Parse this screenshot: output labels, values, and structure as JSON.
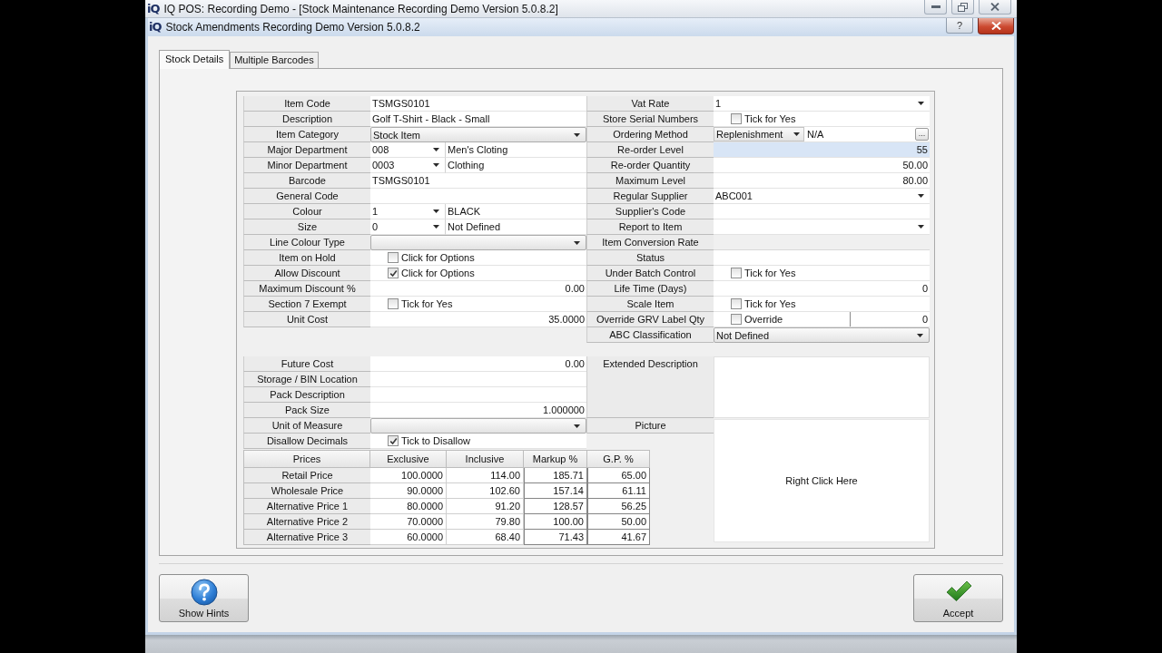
{
  "app_window": {
    "logo": "iQ",
    "title": "IQ POS: Recording Demo - [Stock Maintenance Recording Demo Version 5.0.8.2]"
  },
  "dialog": {
    "logo": "iQ",
    "title": "Stock Amendments Recording Demo Version 5.0.8.2",
    "help_button": "?"
  },
  "tabs": [
    {
      "label": "Stock Details",
      "selected": true
    },
    {
      "label": "Multiple Barcodes",
      "selected": false
    }
  ],
  "left_fields": [
    {
      "label": "Item Code",
      "kind": "text",
      "value": "TSMGS0101"
    },
    {
      "label": "Description",
      "kind": "text",
      "value": "Golf T-Shirt - Black - Small"
    },
    {
      "label": "Item Category",
      "kind": "combo",
      "value": "Stock Item"
    },
    {
      "label": "Major Department",
      "kind": "code_dropdown",
      "code": "008",
      "name": "Men's Cloting"
    },
    {
      "label": "Minor Department",
      "kind": "code_dropdown",
      "code": "0003",
      "name": "Clothing"
    },
    {
      "label": "Barcode",
      "kind": "text",
      "value": "TSMGS0101"
    },
    {
      "label": "General Code",
      "kind": "text"
    },
    {
      "label": "Colour",
      "kind": "code_dropdown",
      "code": "1",
      "name": "BLACK"
    },
    {
      "label": "Size",
      "kind": "code_dropdown",
      "code": "0",
      "name": "Not Defined"
    },
    {
      "label": "Line Colour Type",
      "kind": "combo"
    },
    {
      "label": "Item on Hold",
      "kind": "checkbox",
      "checked": false,
      "text": "Click for Options"
    },
    {
      "label": "Allow Discount",
      "kind": "checkbox",
      "checked": true,
      "text": "Click for Options"
    },
    {
      "label": "Maximum Discount %",
      "kind": "number",
      "value": "0.00",
      "focused": false
    },
    {
      "label": "Section 7 Exempt",
      "kind": "checkbox",
      "checked": false,
      "text": "Tick for Yes"
    },
    {
      "label": "Unit Cost",
      "kind": "number",
      "value": "35.0000",
      "focused": false
    }
  ],
  "right_fields": [
    {
      "label": "Vat Rate",
      "kind": "dropdown",
      "value": "1"
    },
    {
      "label": "Store Serial Numbers",
      "kind": "checkbox",
      "checked": false,
      "text": "Tick for Yes"
    },
    {
      "label": "Ordering Method",
      "kind": "ordering",
      "value": "Replenishment",
      "text": "N/A",
      "button": "..."
    },
    {
      "label": "Re-order Level",
      "kind": "number",
      "value": "55",
      "focused": true
    },
    {
      "label": "Re-order Quantity",
      "kind": "number",
      "value": "50.00",
      "focused": false
    },
    {
      "label": "Maximum Level",
      "kind": "number",
      "value": "80.00",
      "focused": false
    },
    {
      "label": "Regular Supplier",
      "kind": "dropdown",
      "value": "ABC001"
    },
    {
      "label": "Supplier's Code",
      "kind": "text"
    },
    {
      "label": "Report to Item",
      "kind": "dropdown"
    },
    {
      "label": "Item Conversion Rate",
      "kind": "readonly"
    },
    {
      "label": "Status",
      "kind": "text"
    },
    {
      "label": "Under Batch Control",
      "kind": "checkbox",
      "checked": false,
      "text": "Tick for Yes"
    },
    {
      "label": "Life Time (Days)",
      "kind": "number",
      "value": "0",
      "focused": false
    },
    {
      "label": "Scale Item",
      "kind": "checkbox",
      "checked": false,
      "text": "Tick for Yes"
    },
    {
      "label": "Override GRV Label Qty",
      "kind": "override",
      "checked": false,
      "text": "Override",
      "value": "0"
    },
    {
      "label": "ABC Classification",
      "kind": "combo",
      "value": "Not Defined"
    }
  ],
  "lower_fields": [
    {
      "label": "Future Cost",
      "kind": "number",
      "value": "0.00",
      "focused": false
    },
    {
      "label": "Storage / BIN Location",
      "kind": "text"
    },
    {
      "label": "Pack Description",
      "kind": "text"
    },
    {
      "label": "Pack Size",
      "kind": "number",
      "value": "1.000000",
      "focused": false
    },
    {
      "label": "Unit of Measure",
      "kind": "combo"
    },
    {
      "label": "Disallow Decimals",
      "kind": "checkbox",
      "checked": true,
      "text": "Tick to Disallow"
    }
  ],
  "extended_description": {
    "label": "Extended Description"
  },
  "picture": {
    "label": "Picture",
    "hint": "Right Click Here"
  },
  "prices": {
    "columns": [
      "Prices",
      "Exclusive",
      "Inclusive",
      "Markup %",
      "G.P. %"
    ],
    "rows": [
      {
        "label": "Retail Price",
        "values": [
          "100.0000",
          "114.00",
          "185.71",
          "65.00"
        ]
      },
      {
        "label": "Wholesale Price",
        "values": [
          "90.0000",
          "102.60",
          "157.14",
          "61.11"
        ]
      },
      {
        "label": "Alternative Price 1",
        "values": [
          "80.0000",
          "91.20",
          "128.57",
          "56.25"
        ]
      },
      {
        "label": "Alternative Price 2",
        "values": [
          "70.0000",
          "79.80",
          "100.00",
          "50.00"
        ]
      },
      {
        "label": "Alternative Price 3",
        "values": [
          "60.0000",
          "68.40",
          "71.43",
          "41.67"
        ]
      }
    ]
  },
  "buttons": [
    {
      "label": "Show Hints",
      "kind": "hints"
    },
    {
      "label": "Accept",
      "kind": "accept"
    }
  ]
}
